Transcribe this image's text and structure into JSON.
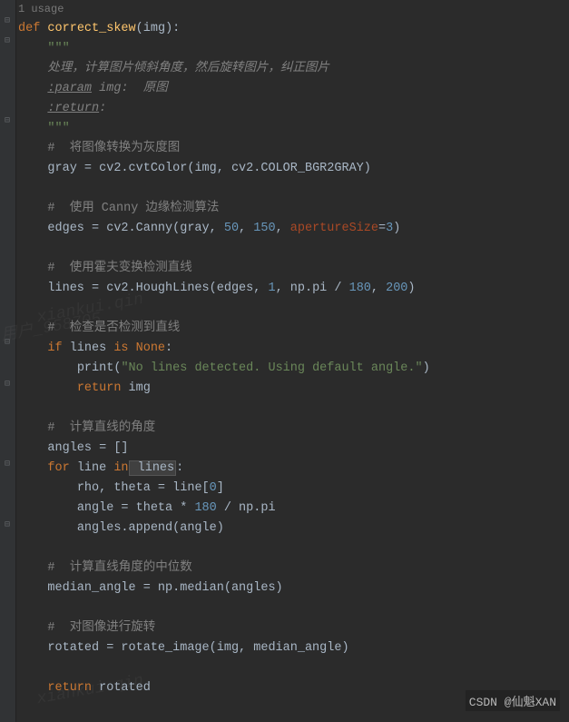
{
  "usage_text": "1 usage",
  "fn_def": {
    "kw_def": "def",
    "name": "correct_skew",
    "param": "img"
  },
  "docstring": {
    "q": "\"\"\"",
    "desc": "处理，计算图片倾斜角度，然后旋转图片，纠正图片",
    "param_tag": ":param",
    "param_rest": " img:  原图",
    "return_tag": ":return",
    "return_rest": ":"
  },
  "comments": {
    "c1": "#  将图像转换为灰度图",
    "c2": "#  使用 Canny 边缘检测算法",
    "c3": "#  使用霍夫变换检测直线",
    "c4": "#  检查是否检测到直线",
    "c5": "#  计算直线的角度",
    "c6": "#  计算直线角度的中位数",
    "c7": "#  对图像进行旋转"
  },
  "code": {
    "gray": {
      "v": "gray",
      "eq": " = ",
      "c": "cv2.cvtColor(img",
      "comma": ", ",
      "flag": "cv2.COLOR_BGR2GRAY)"
    },
    "edges": {
      "pre": "edges = cv2.Canny(gray",
      "n1": "50",
      "n2": "150",
      "kw": "apertureSize",
      "n3": "3"
    },
    "lines": {
      "pre": "lines = cv2.HoughLines(edges",
      "n1": "1",
      "np": "np.pi",
      "div": " / ",
      "n2": "180",
      "n3": "200"
    },
    "if_none": {
      "kw_if": "if",
      "var": " lines ",
      "kw_is": "is",
      "none": " None",
      "colon": ":"
    },
    "print": {
      "fn": "print",
      "str": "\"No lines detected. Using default angle.\""
    },
    "return_img": {
      "kw": "return",
      "val": " img"
    },
    "angles_init": "angles = []",
    "for": {
      "kw_for": "for",
      "var": " line ",
      "kw_in": "in",
      "iter": " lines",
      "colon": ":"
    },
    "unpack": {
      "pre": "rho",
      "comma": ", ",
      "theta": "theta = line[",
      "idx": "0",
      "close": "]"
    },
    "angle_calc": {
      "pre": "angle = theta * ",
      "n1": "180",
      "div": " / np.pi"
    },
    "append": "angles.append(angle)",
    "median": "median_angle = np.median(angles)",
    "rotate": {
      "pre": "rotated = rotate_image(img",
      "comma": ", ",
      "arg": "median_angle)"
    },
    "return_rot": {
      "kw": "return",
      "val": " rotated"
    }
  },
  "csdn": "CSDN @仙魁XAN",
  "watermarks": {
    "w1": "xiankui.qin",
    "w2": "用户_958705",
    "w3": "xiankui.qin"
  }
}
